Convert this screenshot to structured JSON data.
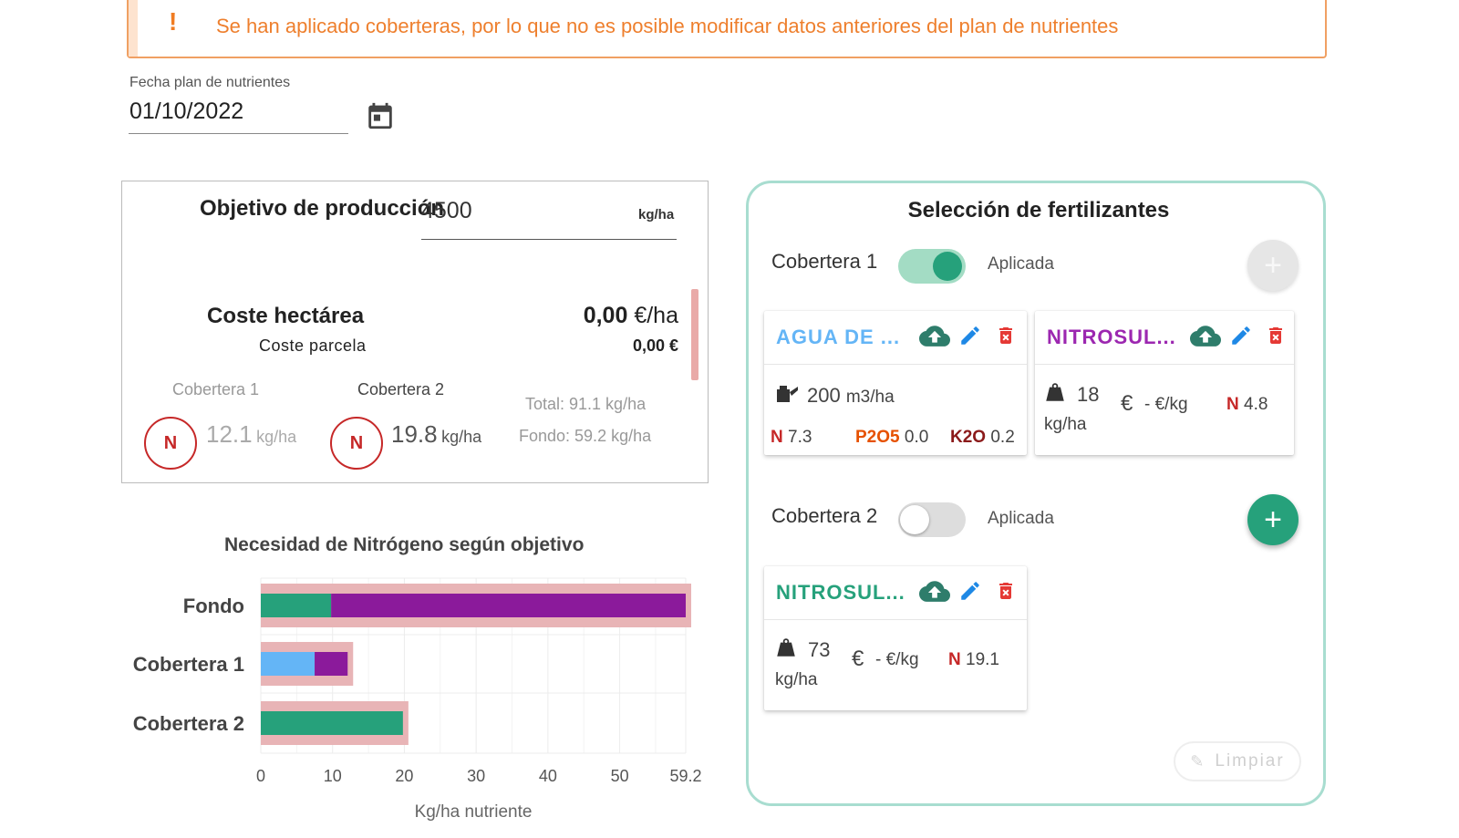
{
  "warning": {
    "icon": "exclamation-icon",
    "text": "Se han aplicado coberteras, por lo que no es posible modificar datos anteriores del plan de nutrientes",
    "color": "#ee7f2d"
  },
  "date_field": {
    "label": "Fecha plan de nutrientes",
    "value": "01/10/2022",
    "icon": "calendar-icon"
  },
  "production": {
    "objetivo_label": "Objetivo de producción",
    "objetivo_value": "4500",
    "objetivo_unit": "kg/ha",
    "coste_hectarea_label": "Coste hectárea",
    "coste_hectarea_value": "0,00",
    "coste_hectarea_unit": "€/ha",
    "coste_parcela_label": "Coste parcela",
    "coste_parcela_value": "0,00 €",
    "coberteras": [
      {
        "label": "Cobertera 1",
        "nutrient": "N",
        "value": "12.1",
        "unit": "kg/ha",
        "active": false
      },
      {
        "label": "Cobertera 2",
        "nutrient": "N",
        "value": "19.8",
        "unit": "kg/ha",
        "active": true
      }
    ],
    "total": "Total: 91.1 kg/ha",
    "fondo": "Fondo: 59.2 kg/ha"
  },
  "chart_data": {
    "type": "bar",
    "orientation": "horizontal",
    "stacked": true,
    "title": "Necesidad de Nitrógeno según objetivo",
    "xlabel": "Kg/ha nutriente",
    "ylabel": "",
    "categories": [
      "Fondo",
      "Cobertera 1",
      "Cobertera 2"
    ],
    "series": [
      {
        "values": [
          9.8,
          7.5,
          19.8
        ],
        "colors": [
          "#26a17b",
          "#64b5f6",
          "#26a17b"
        ]
      },
      {
        "values": [
          49.4,
          4.6,
          0
        ],
        "colors": [
          "#8b1a9b",
          "#8b1a9b",
          "#8b1a9b"
        ]
      }
    ],
    "target_values": [
      59.2,
      12.1,
      19.8
    ],
    "target_color": "#e8b4b6",
    "xticks": [
      0,
      10,
      20,
      30,
      40,
      50,
      59.2
    ],
    "xlim": [
      0,
      59.2
    ],
    "grid": true
  },
  "fertilizers": {
    "title": "Selección de fertilizantes",
    "coberteras": [
      {
        "label": "Cobertera 1",
        "toggle_on": true,
        "aplicada_label": "Aplicada",
        "add_button_enabled": false,
        "cards": [
          {
            "name": "AGUA DE ...",
            "name_color": "#64b5f6",
            "dose_icon": "watering-can-icon",
            "dose_value": "200",
            "dose_unit": "m3/ha",
            "nutrients": [
              {
                "label": "N",
                "value": "7.3",
                "color": "#c62828"
              },
              {
                "label": "P2O5",
                "value": "0.0",
                "color": "#e65100"
              },
              {
                "label": "K2O",
                "value": "0.2",
                "color": "#8b1a1a"
              }
            ]
          },
          {
            "name": "NITROSUL...",
            "name_color": "#9c27b0",
            "dose_icon": "weight-icon",
            "dose_value": "18",
            "dose_unit": "kg/ha",
            "price": "- €/kg",
            "nutrients": [
              {
                "label": "N",
                "value": "4.8",
                "color": "#c62828"
              }
            ]
          }
        ]
      },
      {
        "label": "Cobertera 2",
        "toggle_on": false,
        "aplicada_label": "Aplicada",
        "add_button_enabled": true,
        "cards": [
          {
            "name": "NITROSUL...",
            "name_color": "#26a17b",
            "dose_icon": "weight-icon",
            "dose_value": "73",
            "dose_unit": "kg/ha",
            "price": "- €/kg",
            "nutrients": [
              {
                "label": "N",
                "value": "19.1",
                "color": "#c62828"
              }
            ]
          }
        ]
      }
    ],
    "limpiar_label": "Limpiar"
  },
  "colors": {
    "accent_green": "#26a17b",
    "panel_border": "#a8ddd0",
    "danger": "#e53935",
    "edit_blue": "#1e88e5",
    "cloud_green": "#2e7d6b"
  }
}
